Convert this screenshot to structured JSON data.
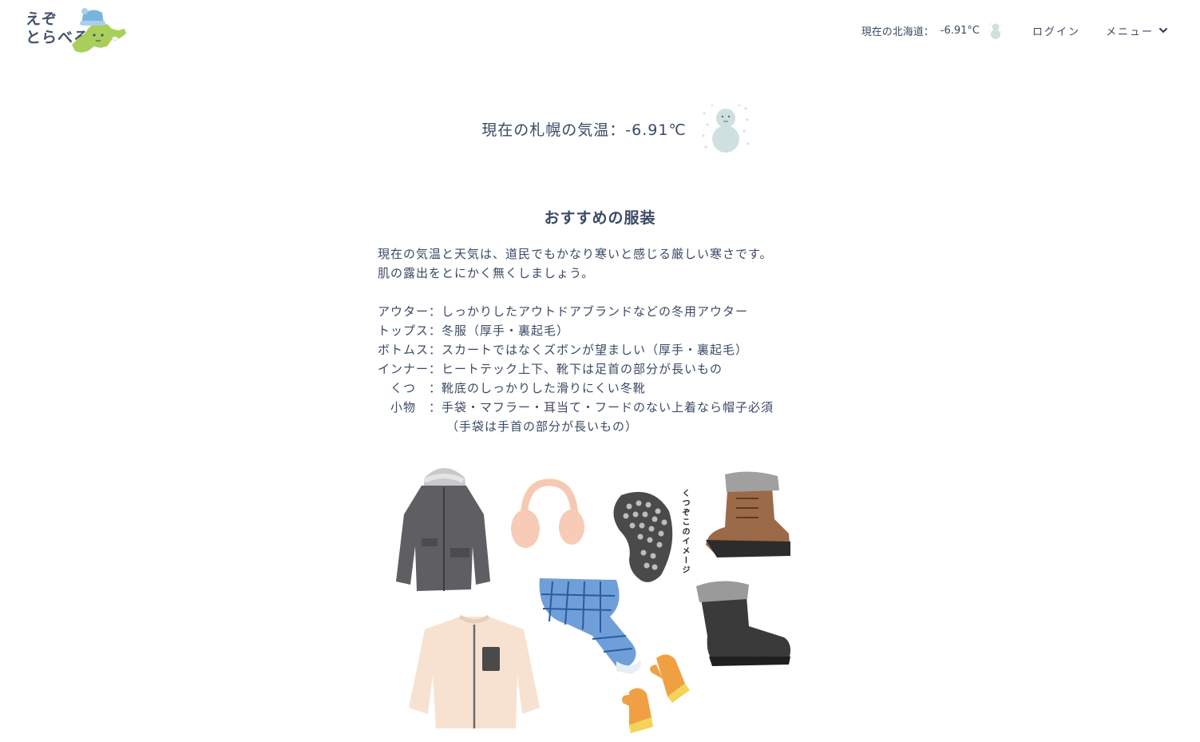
{
  "header": {
    "logo_line1": "えぞ",
    "logo_line2": "とらべる",
    "temp_label": "現在の北海道：",
    "temp_value": "-6.91°C",
    "login_label": "ログイン",
    "menu_label": "メニュー"
  },
  "current": {
    "text": "現在の札幌の気温：-6.91℃"
  },
  "recommend": {
    "title": "おすすめの服装",
    "intro_line1": "現在の気温と天気は、道民でもかなり寒いと感じる厳しい寒さです。",
    "intro_line2": "肌の露出をとにかく無くしましょう。",
    "items": [
      {
        "label": "アウター：",
        "text": "しっかりしたアウトドアブランドなどの冬用アウター"
      },
      {
        "label": "トップス：",
        "text": "冬服（厚手・裏起毛）"
      },
      {
        "label": "ボトムス：",
        "text": "スカートではなくズボンが望ましい（厚手・裏起毛）"
      },
      {
        "label": "インナー：",
        "text": "ヒートテック上下、靴下は足首の部分が長いもの"
      },
      {
        "label": "　くつ　：",
        "text": "靴底のしっかりした滑りにくい冬靴"
      },
      {
        "label": "　小物　：",
        "text": "手袋・マフラー・耳当て・フードのない上着なら帽子必須"
      }
    ],
    "note": "（手袋は手首の部分が長いもの）",
    "sole_caption": "くつぞこのイメージ"
  },
  "colors": {
    "text": "#3a4a64",
    "logo_green": "#a9cf5a",
    "hat_blue": "#7ab4dc",
    "snowman": "#cfe0e0"
  },
  "icons": [
    "snowman-icon",
    "chevron-down-icon",
    "hokkaido-logo-icon"
  ]
}
